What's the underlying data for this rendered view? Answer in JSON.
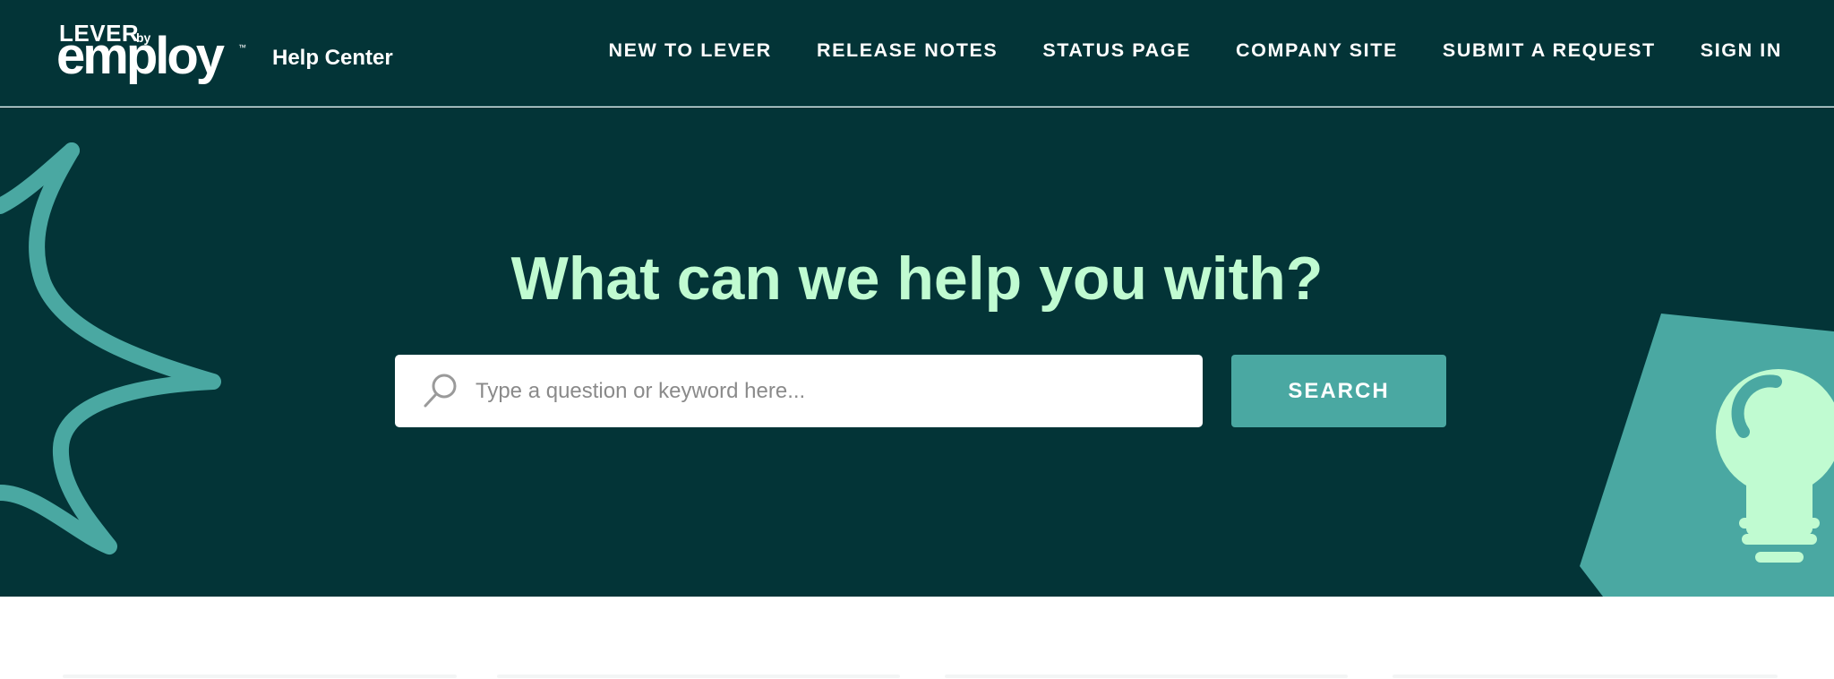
{
  "brand": {
    "logo_top": "LEVER",
    "logo_by": "by",
    "logo_main": "employ",
    "logo_tm": "™",
    "section": "Help Center"
  },
  "nav": {
    "items": [
      {
        "label": "NEW TO LEVER"
      },
      {
        "label": "RELEASE NOTES"
      },
      {
        "label": "STATUS PAGE"
      },
      {
        "label": "COMPANY SITE"
      },
      {
        "label": "SUBMIT A REQUEST"
      },
      {
        "label": "SIGN IN"
      }
    ]
  },
  "hero": {
    "title": "What can we help you with?"
  },
  "search": {
    "placeholder": "Type a question or keyword here...",
    "value": "",
    "button_label": "SEARCH",
    "icon": "search-icon"
  },
  "colors": {
    "dark_teal": "#033437",
    "mint": "#c0fbd1",
    "teal": "#4aa8a2",
    "white": "#ffffff"
  }
}
